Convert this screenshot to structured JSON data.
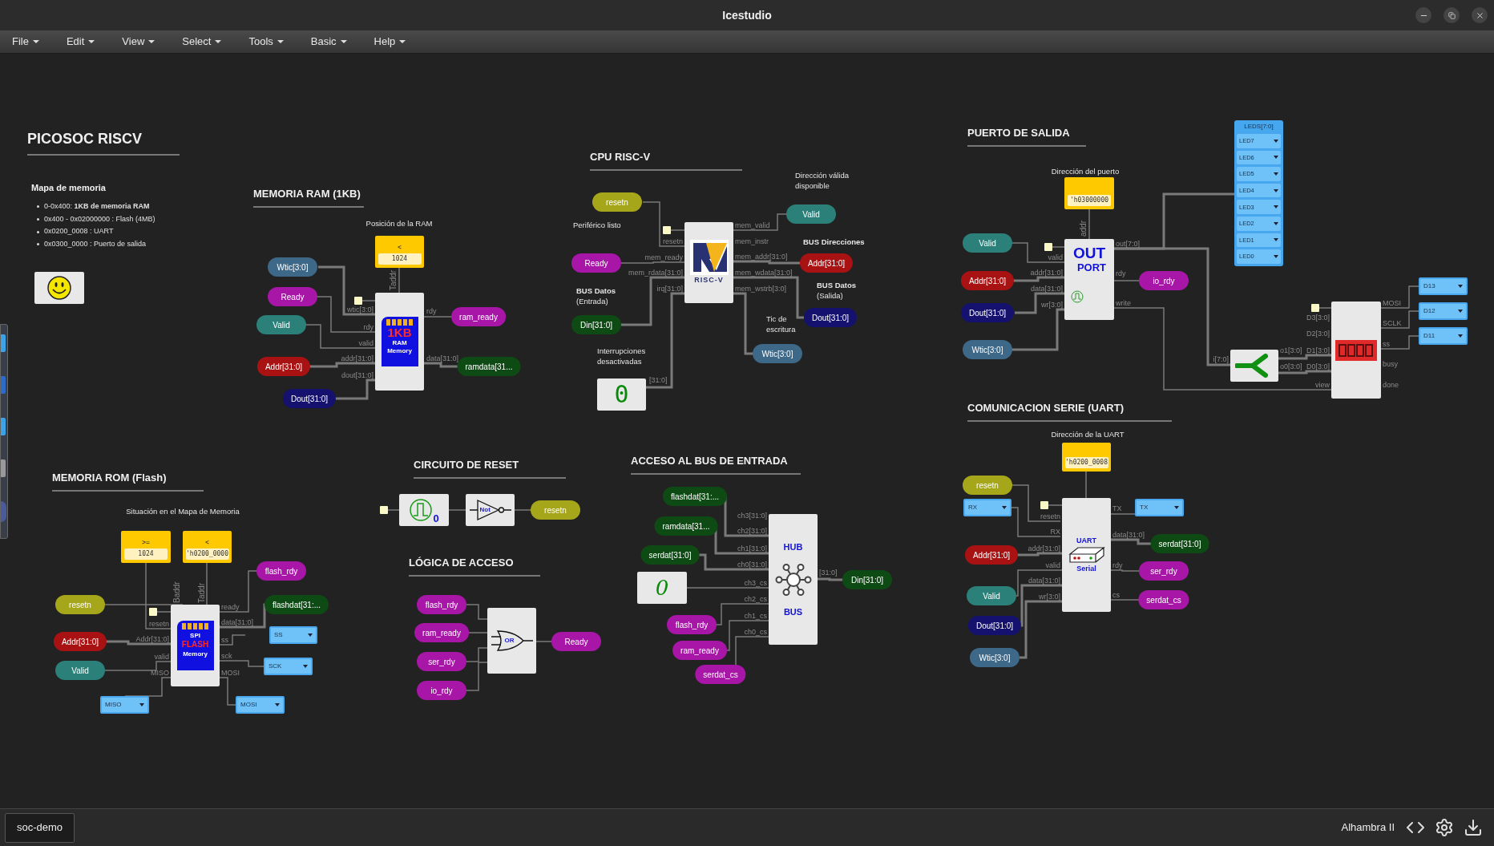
{
  "window": {
    "title": "Icestudio"
  },
  "menu": [
    {
      "label": "File"
    },
    {
      "label": "Edit"
    },
    {
      "label": "View"
    },
    {
      "label": "Select"
    },
    {
      "label": "Tools"
    },
    {
      "label": "Basic"
    },
    {
      "label": "Help"
    }
  ],
  "titles": [
    "PICOSOC RISCV",
    "MEMORIA RAM (1KB)",
    "CPU RISC-V",
    "PUERTO DE SALIDA",
    "COMUNICACION SERIE (UART)",
    "MEMORIA ROM (Flash)",
    "CIRCUITO DE RESET",
    "LÓGICA DE ACCESO",
    "ACCESO AL BUS DE ENTRADA"
  ],
  "memory_map": {
    "heading": "Mapa de memoria",
    "items": [
      "0-0x400: **1KB de memoria RAM**",
      "0x400 - 0x02000000 : Flash (4MB)",
      "0x0200_0008 : UART",
      "0x0300_0000 : Puerto de salida"
    ]
  },
  "notes": [
    {
      "text": "Posición de la RAM",
      "bold": false
    },
    {
      "text": "Dirección válida disponible",
      "bold": false
    },
    {
      "text": "Periférico listo",
      "bold": false
    },
    {
      "text": "BUS Direcciones",
      "bold": true
    },
    {
      "text": "**BUS Datos** (Entrada)",
      "bold": false
    },
    {
      "text": "**BUS Datos** (Salida)",
      "bold": false
    },
    {
      "text": "Tic de escritura",
      "bold": false
    },
    {
      "text": "Interrupciones desactivadas",
      "bold": false
    },
    {
      "text": "Dirección del puerto",
      "bold": false
    },
    {
      "text": "Dirección de la UART",
      "bold": false
    },
    {
      "text": "Situación en el Mapa de Memoria",
      "bold": false
    }
  ],
  "labels": [
    {
      "text": "Wtic[3:0]",
      "color": "#3e6888"
    },
    {
      "text": "Ready",
      "color": "#a816a8"
    },
    {
      "text": "Valid",
      "color": "#2b8079"
    },
    {
      "text": "Addr[31:0]",
      "color": "#a81212"
    },
    {
      "text": "Dout[31:0]",
      "color": "#14126e"
    },
    {
      "text": "ram_ready",
      "color": "#a816a8"
    },
    {
      "text": "ramdata[31...",
      "color": "#0e4b14"
    },
    {
      "text": "resetn",
      "color": "#a6a61a"
    },
    {
      "text": "Ready",
      "color": "#a816a8"
    },
    {
      "text": "Din[31:0]",
      "color": "#0e4b14"
    },
    {
      "text": "Valid",
      "color": "#2b8079"
    },
    {
      "text": "Addr[31:0]",
      "color": "#a81212"
    },
    {
      "text": "Dout[31:0]",
      "color": "#14126e"
    },
    {
      "text": "Wtic[3:0]",
      "color": "#3e6888"
    },
    {
      "text": "Valid",
      "color": "#2b8079"
    },
    {
      "text": "Addr[31:0]",
      "color": "#a81212"
    },
    {
      "text": "Dout[31:0]",
      "color": "#14126e"
    },
    {
      "text": "Wtic[3:0]",
      "color": "#3e6888"
    },
    {
      "text": "io_rdy",
      "color": "#a816a8"
    },
    {
      "text": "resetn",
      "color": "#a6a61a"
    },
    {
      "text": "Addr[31:0]",
      "color": "#a81212"
    },
    {
      "text": "Valid",
      "color": "#2b8079"
    },
    {
      "text": "Dout[31:0]",
      "color": "#14126e"
    },
    {
      "text": "Wtic[3:0]",
      "color": "#3e6888"
    },
    {
      "text": "serdat[31:0]",
      "color": "#0e4b14"
    },
    {
      "text": "ser_rdy",
      "color": "#a816a8"
    },
    {
      "text": "serdat_cs",
      "color": "#a816a8"
    },
    {
      "text": "resetn",
      "color": "#a6a61a"
    },
    {
      "text": "Addr[31:0]",
      "color": "#a81212"
    },
    {
      "text": "Valid",
      "color": "#2b8079"
    },
    {
      "text": "flash_rdy",
      "color": "#a816a8"
    },
    {
      "text": "flashdat[31:...",
      "color": "#0e4b14"
    },
    {
      "text": "resetn",
      "color": "#a6a61a"
    },
    {
      "text": "flash_rdy",
      "color": "#a816a8"
    },
    {
      "text": "ram_ready",
      "color": "#a816a8"
    },
    {
      "text": "ser_rdy",
      "color": "#a816a8"
    },
    {
      "text": "io_rdy",
      "color": "#a816a8"
    },
    {
      "text": "Ready",
      "color": "#a816a8"
    },
    {
      "text": "flashdat[31:...",
      "color": "#0e4b14"
    },
    {
      "text": "ramdata[31...",
      "color": "#0e4b14"
    },
    {
      "text": "serdat[31:0]",
      "color": "#0e4b14"
    },
    {
      "text": "flash_rdy",
      "color": "#a816a8"
    },
    {
      "text": "ram_ready",
      "color": "#a816a8"
    },
    {
      "text": "serdat_cs",
      "color": "#a816a8"
    },
    {
      "text": "Din[31:0]",
      "color": "#0e4b14"
    }
  ],
  "constants": [
    {
      "operator": "<",
      "value": "1024"
    },
    {
      "value": "'h03000000"
    },
    {
      "value": "'h0200_0008"
    },
    {
      "operator": ">=",
      "value": "1024"
    },
    {
      "operator": "<",
      "value": "'h0200_0000"
    }
  ],
  "ports": [
    "Taddr",
    "wtic[3:0]",
    "rdy",
    "valid",
    "addr[31:0]",
    "dout[31:0]",
    "rdy",
    "data[31:0]",
    "resetn",
    "mem_ready",
    "mem_rdata[31:0]",
    "irq[31:0]",
    "mem_valid",
    "mem_instr",
    "mem_addr[31:0]",
    "mem_wdata[31:0]",
    "mem_wstrb[3:0]",
    "[31:0]",
    "addr",
    "valid",
    "addr[31:0]",
    "data[31:0]",
    "wr[3:0]",
    "out[7:0]",
    "rdy",
    "write",
    "i[7:0]",
    "o1[3:0]",
    "o0[3:0]",
    "D3[3:0]",
    "D2[3:0]",
    "D1[3:0]",
    "D0[3:0]",
    "view",
    "MOSI",
    "SCLK",
    "ss",
    "busy",
    "done",
    "resetn",
    "RX",
    "addr[31:0]",
    "valid",
    "data[31:0]",
    "wr[3:0]",
    "TX",
    "data[31:0]",
    "rdy",
    "cs",
    "Baddr",
    "Taddr",
    "resetn",
    "Addr[31:0]",
    "valid",
    "MISO",
    "ready",
    "data[31:0]",
    "ss",
    "sck",
    "MOSI",
    "ch3[31:0]",
    "ch2[31:0]",
    "ch1[31:0]",
    "ch0[31:0]",
    "ch3_cs",
    "ch2_cs",
    "ch1_cs",
    "ch0_cs",
    "[31:0]"
  ],
  "led_pins": {
    "title": "LEDS[7:0]",
    "items": [
      "LED7",
      "LED6",
      "LED5",
      "LED4",
      "LED3",
      "LED2",
      "LED1",
      "LED0"
    ]
  },
  "pins": [
    "D13",
    "D12",
    "D11",
    "RX",
    "TX",
    "SS",
    "SCK",
    "MISO",
    "MOSI"
  ],
  "blocks": [
    {
      "kind": "memory",
      "badge": "1KB",
      "line1": "RAM",
      "line2": "Memory"
    },
    {
      "kind": "cpu",
      "logo_text": "RISC-V"
    },
    {
      "kind": "constant",
      "value": "0"
    },
    {
      "kind": "out_port",
      "line1": "OUT",
      "line2": "PORT"
    },
    {
      "kind": "split"
    },
    {
      "kind": "display"
    },
    {
      "kind": "uart",
      "line1": "UART",
      "line2": "Serial"
    },
    {
      "kind": "memory",
      "line1": "SPI",
      "badge": "FLASH",
      "line2": "Memory"
    },
    {
      "kind": "pulse",
      "value": "0"
    },
    {
      "kind": "not",
      "label": "Not"
    },
    {
      "kind": "or",
      "label": "OR"
    },
    {
      "kind": "constant_italic",
      "value": "0"
    },
    {
      "kind": "hub",
      "line1": "HUB",
      "line2": "BUS"
    },
    {
      "kind": "smiley"
    }
  ],
  "status_bar": {
    "tab": "soc-demo",
    "board": "Alhambra II"
  }
}
